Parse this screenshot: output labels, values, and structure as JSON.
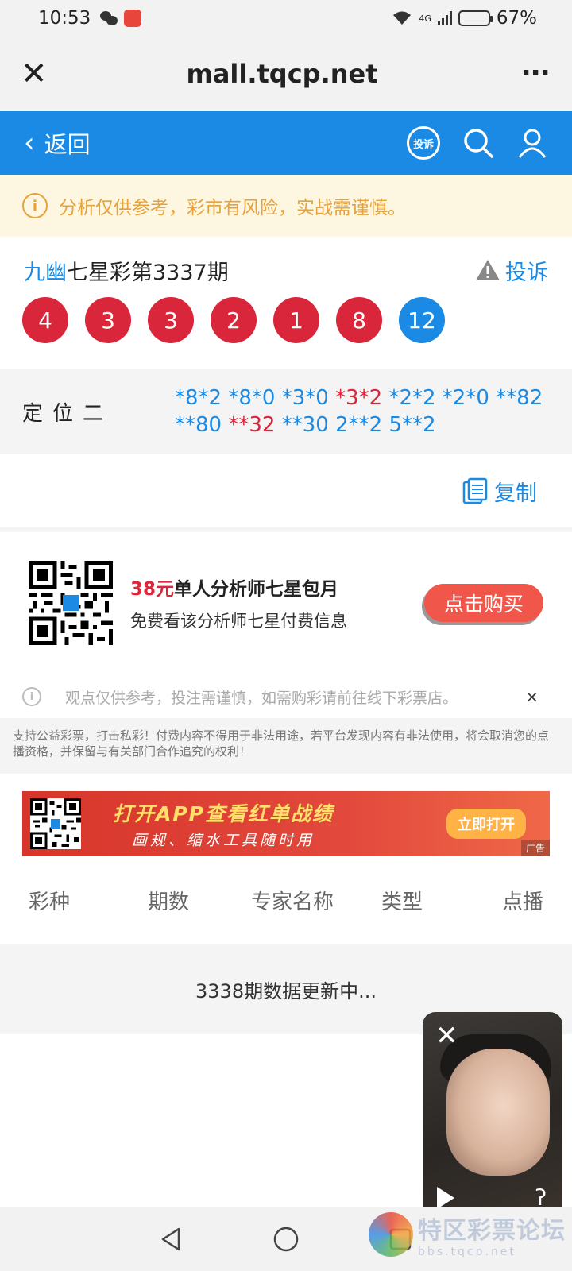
{
  "status_bar": {
    "time": "10:53",
    "battery": "67%",
    "battery_fill": 0.67,
    "network": "4G"
  },
  "browser": {
    "url": "mall.tqcp.net"
  },
  "header": {
    "back_label": "返回",
    "complain_badge": "投诉"
  },
  "notice": {
    "text": "分析仅供参考，彩市有风险，实战需谨慎。"
  },
  "lottery": {
    "author": "九幽",
    "title": "七星彩第3337期",
    "report_label": "投诉",
    "balls": [
      {
        "num": "4",
        "color": "red"
      },
      {
        "num": "3",
        "color": "red"
      },
      {
        "num": "3",
        "color": "red"
      },
      {
        "num": "2",
        "color": "red"
      },
      {
        "num": "1",
        "color": "red"
      },
      {
        "num": "8",
        "color": "red"
      },
      {
        "num": "12",
        "color": "blue"
      }
    ]
  },
  "position": {
    "label": "定位二",
    "line1": [
      "*8*2",
      "*8*0",
      "*3*0",
      "*3*2",
      "*2*2",
      "*2*0",
      "**82"
    ],
    "line2": [
      "**80",
      "**32",
      "**30",
      "2**2",
      "5**2"
    ],
    "highlight_red": [
      "*3*2",
      "**32"
    ]
  },
  "copy_label": "复制",
  "promo": {
    "price": "38元",
    "title": "单人分析师七星包月",
    "subtitle": "免费看该分析师七星付费信息",
    "buy_label": "点击购买"
  },
  "disclaimer": {
    "text": "观点仅供参考，投注需谨慎，如需购彩请前往线下彩票店。",
    "close": "×"
  },
  "legal": {
    "text": "支持公益彩票，打击私彩！付费内容不得用于非法用途，若平台发现内容有非法使用，将会取消您的点播资格，并保留与有关部门合作追究的权利！"
  },
  "banner": {
    "line1": "打开APP查看红单战绩",
    "line2": "画规、缩水工具随时用",
    "open_label": "立即打开",
    "ad_tag": "广告"
  },
  "table": {
    "headers": [
      "彩种",
      "期数",
      "专家名称",
      "类型",
      "点播"
    ],
    "status_row": "3338期数据更新中..."
  },
  "watermark": {
    "title": "特区彩票论坛",
    "sub": "bbs.tqcp.net"
  },
  "colors": {
    "brand_blue": "#1a8ae5",
    "ball_red": "#d9263a",
    "notice_orange": "#e6a23c"
  }
}
